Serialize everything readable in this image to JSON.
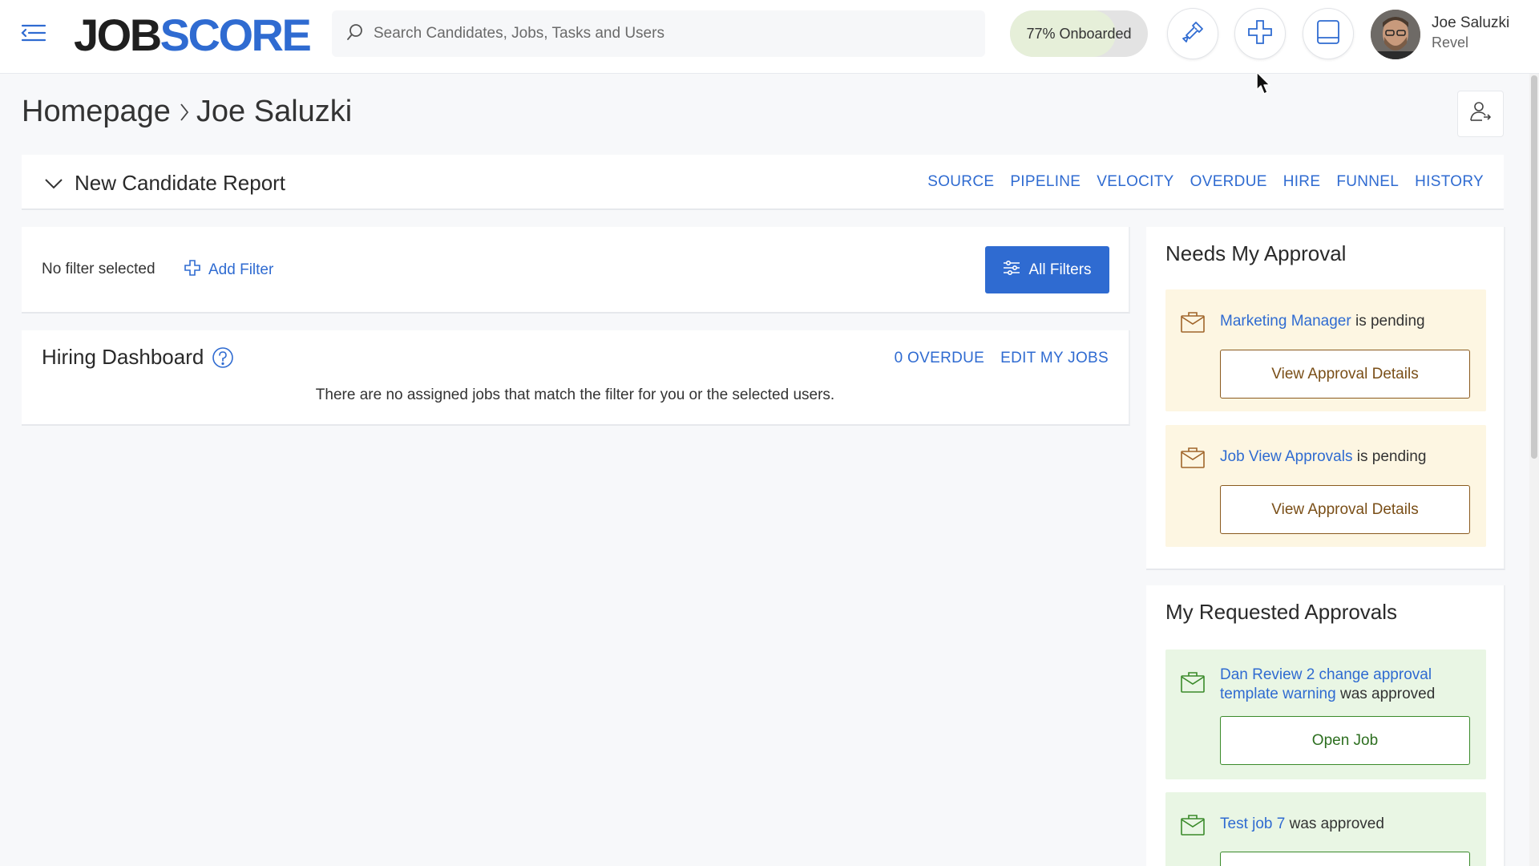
{
  "header": {
    "logo_job": "JOB",
    "logo_score": "SCORE",
    "search_placeholder": "Search Candidates, Jobs, Tasks and Users",
    "onboarded_label": "77% Onboarded",
    "onboarded_fraction": 0.77,
    "user_name": "Joe Saluzki",
    "user_org": "Revel",
    "icons": [
      "menu-icon",
      "wrench-icon",
      "plus-icon",
      "chat-icon"
    ]
  },
  "breadcrumb": {
    "root": "Homepage",
    "current": "Joe Saluzki"
  },
  "report": {
    "title": "New Candidate Report",
    "links": [
      "SOURCE",
      "PIPELINE",
      "VELOCITY",
      "OVERDUE",
      "HIRE",
      "FUNNEL",
      "HISTORY"
    ]
  },
  "filters": {
    "status": "No filter selected",
    "add_label": "Add Filter",
    "all_label": "All Filters"
  },
  "hiring_dashboard": {
    "title": "Hiring Dashboard",
    "overdue_link": "0 OVERDUE",
    "edit_link": "EDIT MY JOBS",
    "empty_message": "There are no assigned jobs that match the filter for you or the selected users."
  },
  "needs_approval": {
    "title": "Needs My Approval",
    "items": [
      {
        "link": "Marketing Manager",
        "status": " is pending",
        "button": "View Approval Details"
      },
      {
        "link": "Job View Approvals",
        "status": " is pending",
        "button": "View Approval Details"
      }
    ]
  },
  "requested_approvals": {
    "title": "My Requested Approvals",
    "items": [
      {
        "link": "Dan Review 2 change approval template warning",
        "status": " was approved",
        "button": "Open Job"
      },
      {
        "link": "Test job 7",
        "status": " was approved",
        "button": ""
      }
    ]
  },
  "colors": {
    "accent": "#2f6bd1",
    "pending_bg": "#fdf6e2",
    "approved_bg": "#e9f6e4"
  }
}
